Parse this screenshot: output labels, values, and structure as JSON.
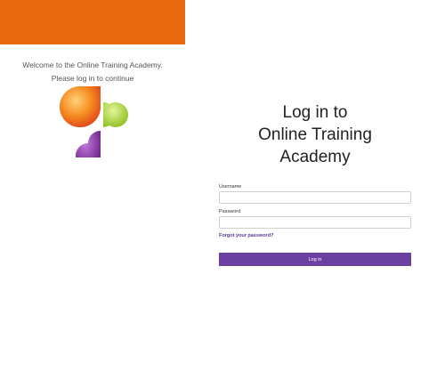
{
  "left": {
    "welcome_line1": "Welcome to the Online Training Academy.",
    "welcome_line2": "Please log in to continue",
    "logo_icon": "abstract-fruit-logo-icon"
  },
  "login": {
    "title_line1": "Log in to",
    "title_line2": "Online Training",
    "title_line3": "Academy",
    "username_label": "Username",
    "password_label": "Password",
    "forgot_link": "Forgot your password?",
    "login_button": "Log in"
  },
  "colors": {
    "banner": "#ea6a0e",
    "accent": "#6b3fa0",
    "link": "#5b3a99"
  }
}
